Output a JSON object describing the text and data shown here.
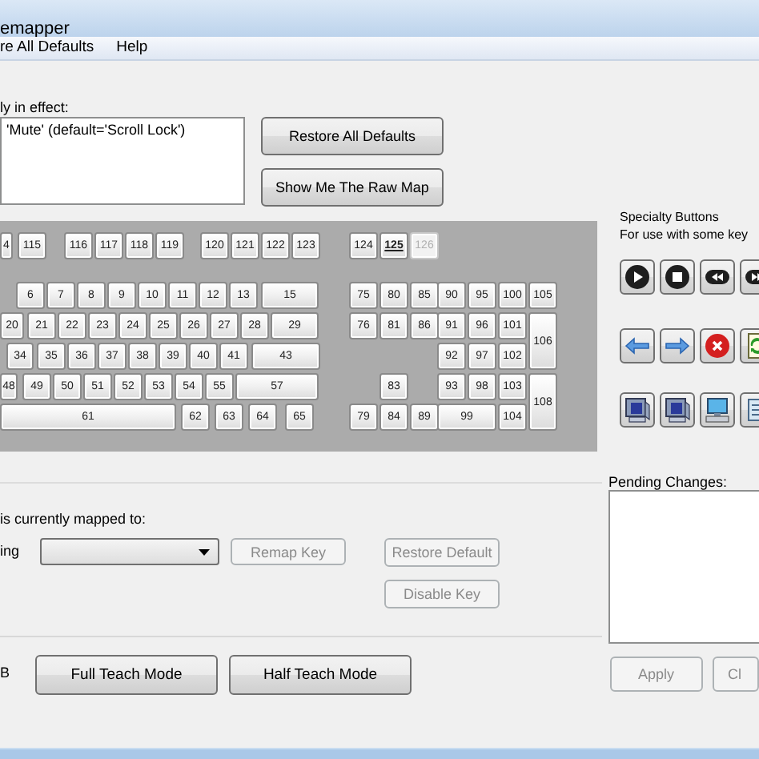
{
  "window": {
    "title": "emapper"
  },
  "menu": [
    {
      "label": "re All Defaults"
    },
    {
      "label": "Help"
    }
  ],
  "effect": {
    "label": "ly in effect:",
    "mappings": [
      "'Mute' (default='Scroll Lock')"
    ],
    "buttons": [
      {
        "label": "Restore All Defaults"
      },
      {
        "label": "Show Me The Raw Map"
      }
    ]
  },
  "keyboard": {
    "function_keys": [
      {
        "label": "4",
        "disabled": false,
        "remapped": false
      },
      {
        "label": "115",
        "disabled": false,
        "remapped": false
      },
      {
        "label": "116",
        "disabled": false,
        "remapped": false
      },
      {
        "label": "117",
        "disabled": false,
        "remapped": false
      },
      {
        "label": "118",
        "disabled": false,
        "remapped": false
      },
      {
        "label": "119",
        "disabled": false,
        "remapped": false
      },
      {
        "label": "120",
        "disabled": false,
        "remapped": false
      },
      {
        "label": "121",
        "disabled": false,
        "remapped": false
      },
      {
        "label": "122",
        "disabled": false,
        "remapped": false
      },
      {
        "label": "123",
        "disabled": false,
        "remapped": false
      },
      {
        "label": "124",
        "disabled": false,
        "remapped": false
      },
      {
        "label": "125",
        "disabled": false,
        "remapped": true
      },
      {
        "label": "126",
        "disabled": true,
        "remapped": false
      }
    ],
    "main_rows": [
      [
        "6",
        "7",
        "8",
        "9",
        "10",
        "11",
        "12",
        "13",
        "15"
      ],
      [
        "20",
        "21",
        "22",
        "23",
        "24",
        "25",
        "26",
        "27",
        "28",
        "29"
      ],
      [
        "34",
        "35",
        "36",
        "37",
        "38",
        "39",
        "40",
        "41",
        "43"
      ],
      [
        "48",
        "49",
        "50",
        "51",
        "52",
        "53",
        "54",
        "55",
        "57"
      ],
      [
        "61",
        "62",
        "63",
        "64",
        "65"
      ]
    ],
    "nav_keys": [
      "75",
      "80",
      "85",
      "76",
      "81",
      "86",
      "83",
      "79",
      "84",
      "89"
    ],
    "numpad_keys": [
      "90",
      "95",
      "100",
      "105",
      "91",
      "96",
      "101",
      "106",
      "92",
      "97",
      "102",
      "93",
      "98",
      "103",
      "108",
      "99",
      "104"
    ]
  },
  "specialty": {
    "title": "Specialty Buttons",
    "hint": "For use with some key"
  },
  "mapping": {
    "label": "is currently mapped to:",
    "field_label": "ing",
    "buttons": [
      {
        "label": "Remap Key",
        "disabled": true
      },
      {
        "label": "Restore Default",
        "disabled": true
      },
      {
        "label": "Disable Key",
        "disabled": true
      }
    ]
  },
  "teach": {
    "label": "B",
    "buttons": [
      {
        "label": "Full Teach Mode",
        "disabled": false
      },
      {
        "label": "Half Teach Mode",
        "disabled": false
      }
    ]
  },
  "pending": {
    "label": "Pending Changes:",
    "buttons": [
      {
        "label": "Apply",
        "disabled": true
      },
      {
        "label": "Cl",
        "disabled": true
      }
    ]
  }
}
